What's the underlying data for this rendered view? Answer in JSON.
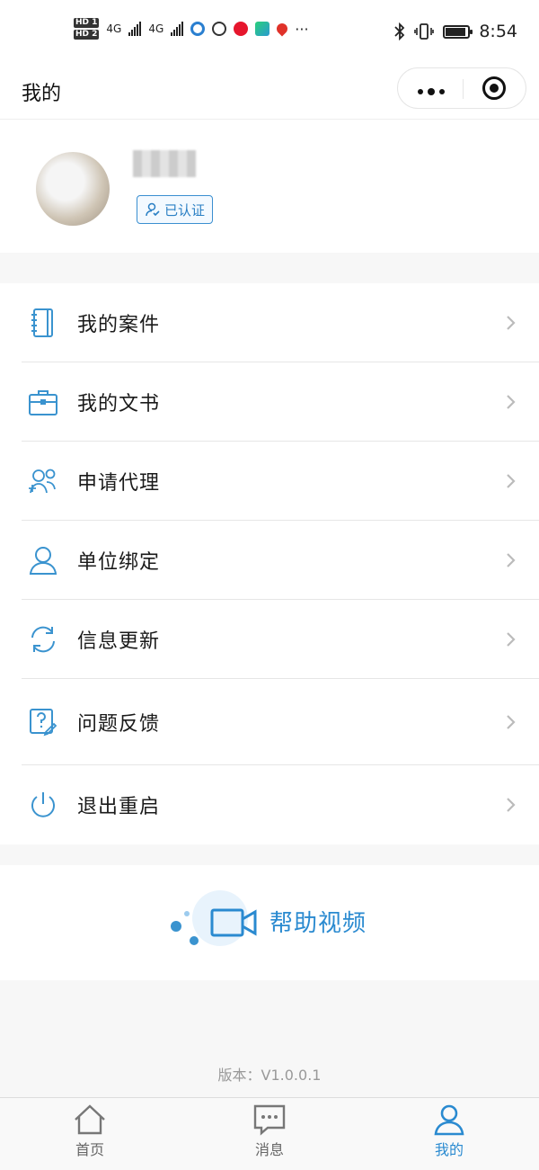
{
  "status_bar": {
    "network_1": "4G",
    "network_2": "4G",
    "hd_1": "HD 1",
    "hd_2": "HD 2",
    "more": "···",
    "time": "8:54",
    "battery_level": 0.85
  },
  "nav": {
    "title": "我的"
  },
  "profile": {
    "verified_badge": "已认证"
  },
  "menu": [
    {
      "label": "我的案件",
      "icon": "notebook-icon"
    },
    {
      "label": "我的文书",
      "icon": "briefcase-icon"
    },
    {
      "label": "申请代理",
      "icon": "add-users-icon"
    },
    {
      "label": "单位绑定",
      "icon": "user-icon"
    },
    {
      "label": "信息更新",
      "icon": "refresh-icon"
    },
    {
      "label": "问题反馈",
      "icon": "feedback-icon"
    },
    {
      "label": "退出重启",
      "icon": "power-icon"
    }
  ],
  "help": {
    "label": "帮助视频"
  },
  "version": "版本：V1.0.0.1",
  "tabs": [
    {
      "label": "首页",
      "icon": "home-icon",
      "active": false
    },
    {
      "label": "消息",
      "icon": "message-icon",
      "active": false
    },
    {
      "label": "我的",
      "icon": "profile-icon",
      "active": true
    }
  ],
  "colors": {
    "accent": "#2a8ad0",
    "icon_blue": "#3a93cf"
  }
}
